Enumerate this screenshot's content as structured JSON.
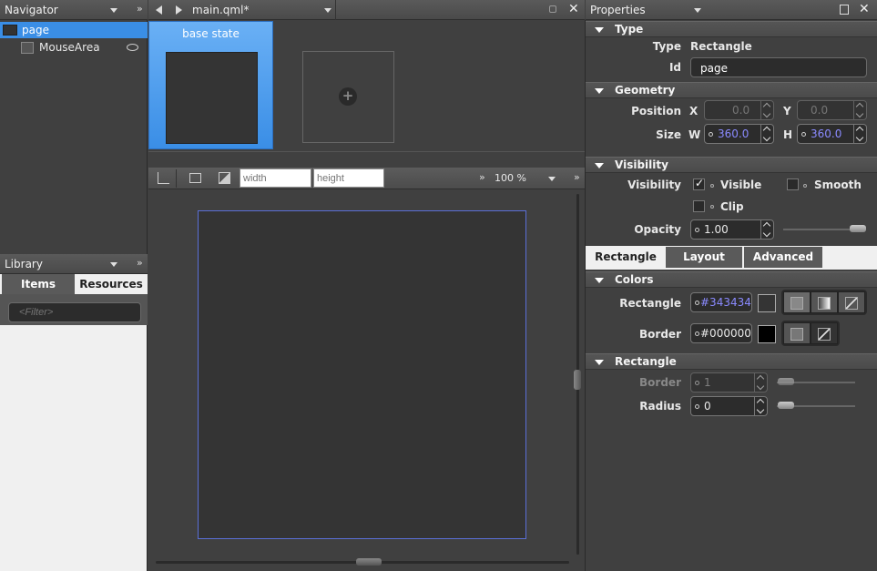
{
  "navigator": {
    "title": "Navigator",
    "items": [
      {
        "label": "page"
      },
      {
        "label": "MouseArea"
      }
    ]
  },
  "library": {
    "title": "Library",
    "tabs": [
      "Items",
      "Resources"
    ],
    "filter_placeholder": "<Filter>"
  },
  "editor": {
    "file": "main.qml*",
    "state_label": "base state",
    "width_placeholder": "width",
    "height_placeholder": "height",
    "zoom": "100 %"
  },
  "properties": {
    "title": "Properties",
    "type_section": "Type",
    "type_label": "Type",
    "type_value": "Rectangle",
    "id_label": "Id",
    "id_value": "page",
    "geometry_section": "Geometry",
    "position_label": "Position",
    "x_label": "X",
    "x_value": "0.0",
    "y_label": "Y",
    "y_value": "0.0",
    "size_label": "Size",
    "w_label": "W",
    "w_value": "360.0",
    "h_label": "H",
    "h_value": "360.0",
    "visibility_section": "Visibility",
    "visibility_label": "Visibility",
    "visible_label": "Visible",
    "smooth_label": "Smooth",
    "clip_label": "Clip",
    "opacity_label": "Opacity",
    "opacity_value": "1.00",
    "tabs": [
      "Rectangle",
      "Layout",
      "Advanced"
    ],
    "colors_section": "Colors",
    "rect_color_label": "Rectangle",
    "rect_color": "#343434",
    "border_color_label": "Border",
    "border_color": "#000000",
    "rect_section": "Rectangle",
    "border_label": "Border",
    "border_value": "1",
    "radius_label": "Radius",
    "radius_value": "0"
  },
  "colors": {
    "accent": "#3a8ee6",
    "canvas": "#343434",
    "bg": "#404040"
  }
}
